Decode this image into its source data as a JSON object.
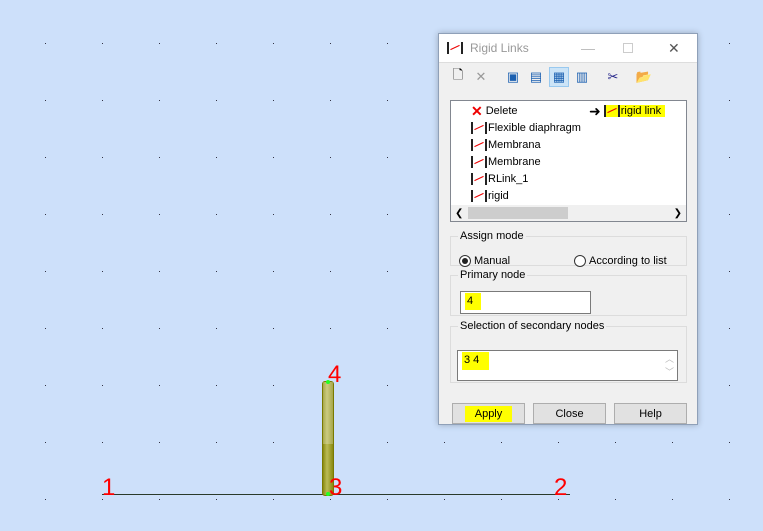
{
  "canvas": {
    "nodes": [
      {
        "id": "1",
        "label": "1"
      },
      {
        "id": "2",
        "label": "2"
      },
      {
        "id": "3",
        "label": "3"
      },
      {
        "id": "4",
        "label": "4"
      }
    ]
  },
  "dialog": {
    "title": "Rigid Links",
    "toolbar": [
      "new-icon",
      "delete-icon",
      "view1-icon",
      "view2-icon",
      "view3-icon",
      "view4-icon",
      "scissors-icon",
      "open-folder-icon"
    ],
    "list": {
      "items": [
        "Delete",
        "Flexible diaphragm",
        "Membrana",
        "Membrane",
        "RLink_1",
        "rigid"
      ],
      "current": "rigid link"
    },
    "assign_mode": {
      "label": "Assign mode",
      "manual": "Manual",
      "according": "According to list",
      "selected": "Manual"
    },
    "primary_node": {
      "label": "Primary node",
      "value": "4"
    },
    "secondary": {
      "label": "Selection of secondary nodes",
      "value": "3 4"
    },
    "buttons": {
      "apply": "Apply",
      "close": "Close",
      "help": "Help"
    },
    "colors": {
      "highlight": "#ffff00",
      "node_label": "#ff0000"
    }
  }
}
